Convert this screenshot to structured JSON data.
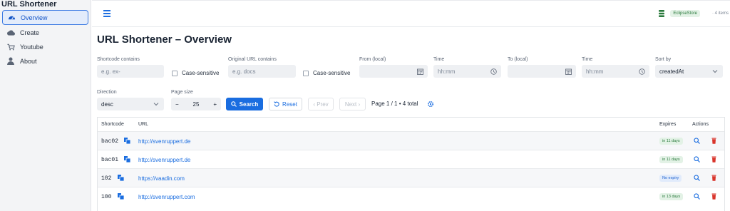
{
  "app_title": "URL Shortener",
  "sidebar": {
    "items": [
      {
        "label": "Overview",
        "icon": "gauge-icon"
      },
      {
        "label": "Create",
        "icon": "cloud-icon"
      },
      {
        "label": "Youtube",
        "icon": "cart-icon"
      },
      {
        "label": "About",
        "icon": "user-icon"
      }
    ]
  },
  "topbar": {
    "store_badge": "EclipseStore",
    "items_count": "· 4 items"
  },
  "page_title": "URL Shortener – Overview",
  "filters": {
    "shortcode_label": "Shortcode contains",
    "shortcode_placeholder": "e.g. ex-",
    "case_sensitive_1": "Case-sensitive",
    "url_label": "Original URL contains",
    "url_placeholder": "e.g. docs",
    "case_sensitive_2": "Case-sensitive",
    "from_label": "From (local)",
    "time_label_1": "Time",
    "time_placeholder_1": "hh:mm",
    "to_label": "To (local)",
    "time_label_2": "Time",
    "time_placeholder_2": "hh:mm",
    "sort_label": "Sort by",
    "sort_value": "createdAt",
    "direction_label": "Direction",
    "direction_value": "desc",
    "page_size_label": "Page size",
    "page_size_value": "25",
    "minus": "−",
    "plus": "+"
  },
  "actions": {
    "search": "Search",
    "reset": "Reset",
    "prev": "‹ Prev",
    "next": "Next ›",
    "page_info": "Page 1 / 1 • 4 total"
  },
  "table": {
    "headers": {
      "shortcode": "Shortcode",
      "url": "URL",
      "expires": "Expires",
      "actions": "Actions"
    },
    "rows": [
      {
        "shortcode": "bac02",
        "url": "http://svenruppert.de",
        "expires": "in 11 days",
        "expiry_kind": "green"
      },
      {
        "shortcode": "bac01",
        "url": "http://svenruppert.de",
        "expires": "in 11 days",
        "expiry_kind": "green"
      },
      {
        "shortcode": "102",
        "url": "https://vaadin.com",
        "expires": "No expiry",
        "expiry_kind": "blue"
      },
      {
        "shortcode": "100",
        "url": "http://svenruppert.com",
        "expires": "in 13 days",
        "expiry_kind": "green"
      }
    ]
  },
  "colors": {
    "accent": "#1a6de0",
    "danger": "#d9342b",
    "success": "#2b7a3d"
  }
}
